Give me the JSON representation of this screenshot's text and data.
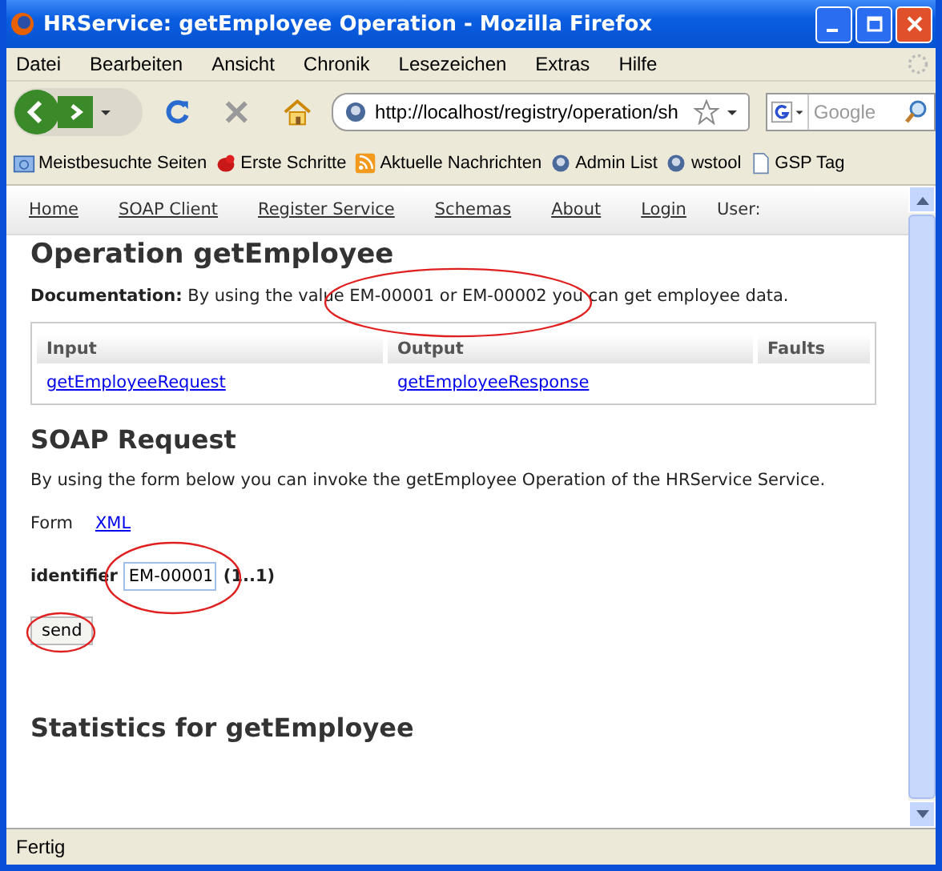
{
  "window": {
    "title": "HRService: getEmployee Operation - Mozilla Firefox"
  },
  "menu": [
    "Datei",
    "Bearbeiten",
    "Ansicht",
    "Chronik",
    "Lesezeichen",
    "Extras",
    "Hilfe"
  ],
  "address": {
    "value": "http://localhost/registry/operation/sh"
  },
  "search": {
    "placeholder": "Google"
  },
  "bookmarks": [
    {
      "label": "Meistbesuchte Seiten",
      "kind": "folder"
    },
    {
      "label": "Erste Schritte",
      "kind": "bug"
    },
    {
      "label": "Aktuelle Nachrichten",
      "kind": "feed"
    },
    {
      "label": "Admin List",
      "kind": "globe"
    },
    {
      "label": "wstool",
      "kind": "globe"
    },
    {
      "label": "GSP Tag",
      "kind": "page"
    }
  ],
  "nav": [
    "Home",
    "SOAP Client",
    "Register Service",
    "Schemas",
    "About",
    "Login"
  ],
  "nav_user": "User:",
  "heading": "Operation getEmployee",
  "documentation": {
    "label": "Documentation:",
    "before": "By using the valu",
    "circled_part": "e EM-00001 or EM-00002 y",
    "after": "ou can get employee data.",
    "circled": true
  },
  "table": {
    "columns": [
      "Input",
      "Output",
      "Faults"
    ],
    "rows": [
      [
        "getEmployeeRequest",
        "getEmployeeResponse",
        ""
      ]
    ]
  },
  "soap_heading": "SOAP Request",
  "soap_text": "By using the form below you can invoke the getEmployee Operation of the HRService Service.",
  "form_tabs": [
    {
      "label": "Form",
      "selected": true
    },
    {
      "label": "XML",
      "selected": false
    }
  ],
  "field": {
    "label": "identifier",
    "value": "EM-00001",
    "cardinality": "(1..1)",
    "circled": true
  },
  "send": {
    "label": "send",
    "circled": true
  },
  "stats_heading": "Statistics for getEmployee",
  "status_bar": "Fertig"
}
